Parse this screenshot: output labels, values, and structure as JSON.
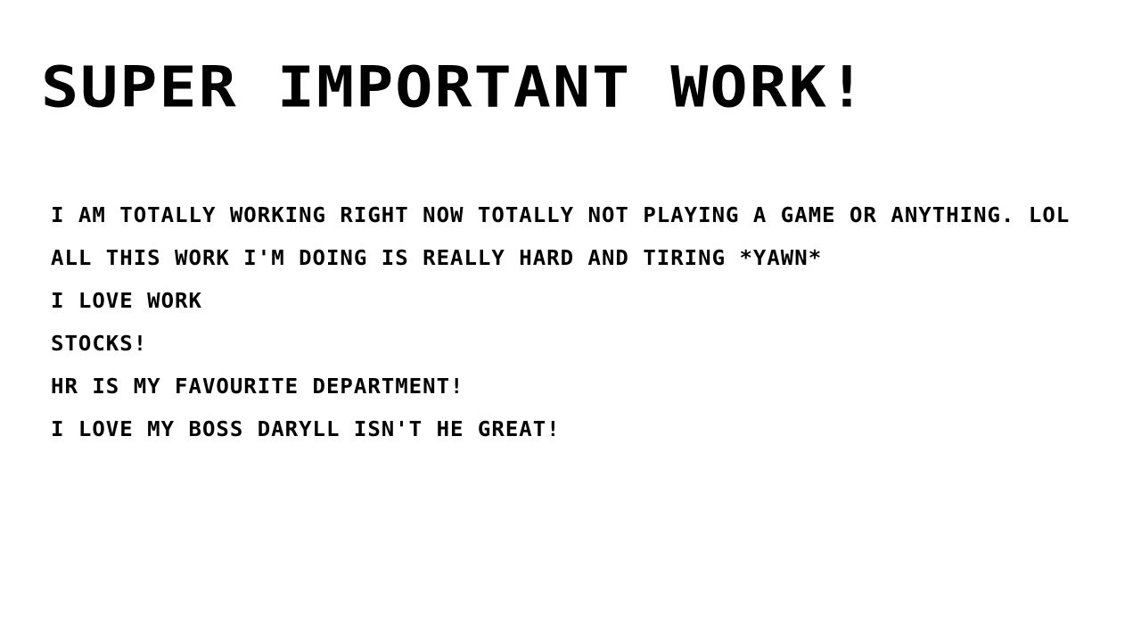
{
  "page": {
    "title": "SUPER IMPORTANT WORK!",
    "lines": [
      "I AM TOTALLY WORKING RIGHT NOW TOTALLY NOT PLAYING A GAME OR ANYTHING. LOL",
      "ALL THIS WORK I'M DOING IS REALLY HARD AND TIRING *YAWN*",
      "I LOVE WORK",
      "STOCKS!",
      "HR IS MY FAVOURITE DEPARTMENT!",
      "I LOVE MY BOSS DARYLL ISN'T HE GREAT!"
    ]
  },
  "colors": {
    "background": "#ffffff",
    "text": "#000000"
  }
}
